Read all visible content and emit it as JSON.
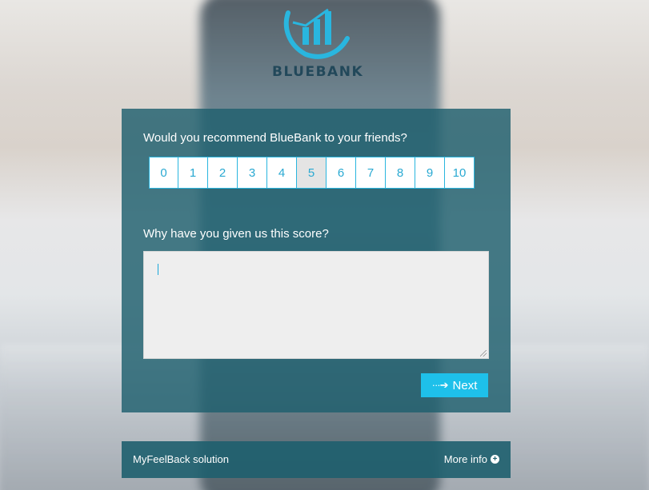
{
  "brand": {
    "name": "BLUEBANK",
    "accent": "#29b6df",
    "dark": "#22485a"
  },
  "survey": {
    "question1": "Would you recommend BlueBank to your friends?",
    "scale": [
      "0",
      "1",
      "2",
      "3",
      "4",
      "5",
      "6",
      "7",
      "8",
      "9",
      "10"
    ],
    "selected": "5",
    "question2": "Why have you given us this score?",
    "answer_value": "",
    "next_label": "Next",
    "next_icon": "dotted-arrow-right-icon"
  },
  "footer": {
    "solution": "MyFeelBack solution",
    "more_info": "More info",
    "more_icon": "plus-circle-icon"
  }
}
